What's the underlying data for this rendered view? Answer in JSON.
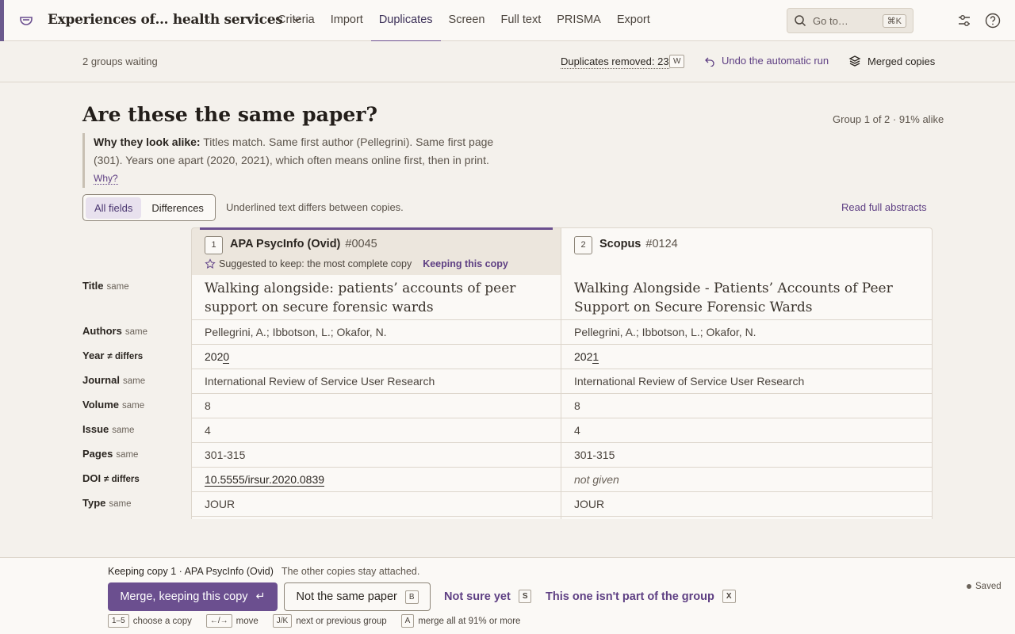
{
  "nav": {
    "project_title": "Experiences of… health services",
    "tabs": [
      {
        "label": "Criteria"
      },
      {
        "label": "Import"
      },
      {
        "label": "Duplicates"
      },
      {
        "label": "Screen"
      },
      {
        "label": "Full text"
      },
      {
        "label": "PRISMA"
      },
      {
        "label": "Export"
      }
    ],
    "active_tab": "Duplicates",
    "goto_placeholder": "Go to…",
    "goto_shortcut": "⌘K"
  },
  "subbar": {
    "waiting": "2 groups waiting",
    "duplicates_removed": "Duplicates removed: 23",
    "duplicates_key": "W",
    "undo_label": "Undo the automatic run",
    "merged_label": "Merged copies"
  },
  "header": {
    "title": "Are these the same paper?",
    "group_info": "Group 1 of 2 · 91% alike",
    "why_lead": "Why they look alike:",
    "why_text": "Titles match. Same first author (Pellegrini). Same first page (301). Years one apart (2020, 2021), which often means online first, then in print.",
    "why_link": "Why?"
  },
  "view": {
    "options": [
      "All fields",
      "Differences"
    ],
    "selected": "All fields",
    "note": "Underlined text differs between copies.",
    "read_full": "Read full abstracts"
  },
  "copies": [
    {
      "num": "1",
      "source": "APA PsycInfo (Ovid)",
      "id": "#0045",
      "suggest": "Suggested to keep: the most complete copy",
      "keeping": "Keeping this copy"
    },
    {
      "num": "2",
      "source": "Scopus",
      "id": "#0124"
    }
  ],
  "fields": [
    {
      "label": "Title",
      "status": "same",
      "a": "Walking alongside: patients’ accounts of peer support on secure forensic wards",
      "b": "Walking Alongside - Patients’ Accounts of Peer Support on Secure Forensic Wards"
    },
    {
      "label": "Authors",
      "status": "same",
      "a": "Pellegrini, A.; Ibbotson, L.; Okafor, N.",
      "b": "Pellegrini, A.; Ibbotson, L.; Okafor, N."
    },
    {
      "label": "Year",
      "status": "≠ differs",
      "a_pre": "202",
      "a_diff": "0",
      "b_pre": "202",
      "b_diff": "1"
    },
    {
      "label": "Journal",
      "status": "same",
      "a": "International Review of Service User Research",
      "b": "International Review of Service User Research"
    },
    {
      "label": "Volume",
      "status": "same",
      "a": "8",
      "b": "8"
    },
    {
      "label": "Issue",
      "status": "same",
      "a": "4",
      "b": "4"
    },
    {
      "label": "Pages",
      "status": "same",
      "a": "301-315",
      "b": "301-315"
    },
    {
      "label": "DOI",
      "status": "≠ differs",
      "a": "10.5555/irsur.2020.0839",
      "b": "not given"
    },
    {
      "label": "Type",
      "status": "same",
      "a": "JOUR",
      "b": "JOUR"
    }
  ],
  "footer": {
    "keeping_line": "Keeping copy 1 · APA PsycInfo (Ovid)",
    "keeping_sub": "The other copies stay attached.",
    "merge_label": "Merge, keeping this copy",
    "merge_key": "↵",
    "not_same_label": "Not the same paper",
    "not_same_key": "B",
    "not_sure_label": "Not sure yet",
    "not_sure_key": "S",
    "not_part_label": "This one isn't part of the group",
    "not_part_key": "X",
    "saved": "Saved",
    "hints": [
      {
        "key": "1–5",
        "text": "choose a copy"
      },
      {
        "key": "←/→",
        "text": "move"
      },
      {
        "key": "J/K",
        "text": "next or previous group"
      },
      {
        "key": "A",
        "text": "merge all at 91% or more"
      }
    ]
  }
}
